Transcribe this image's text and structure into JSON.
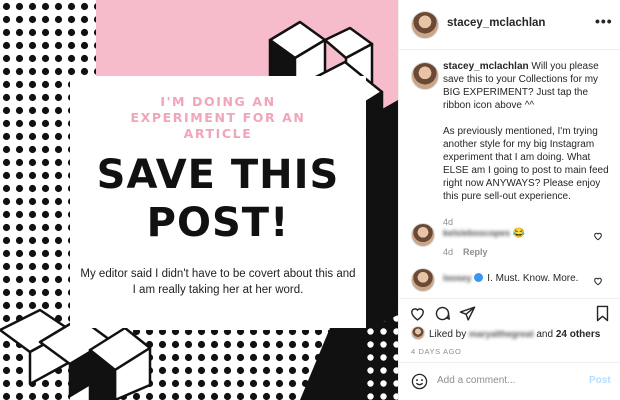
{
  "poster": {
    "pre_title_lines": [
      "I'M DOING AN",
      "EXPERIMENT FOR AN",
      "ARTICLE"
    ],
    "title_lines": [
      "SAVE THIS",
      "POST!"
    ],
    "body": "My editor said I didn't have to be covert about this and I am really taking her at her word.",
    "colors": {
      "pink": "#f7bccb",
      "pink_text": "#f2a4b8",
      "black": "#111111"
    }
  },
  "header": {
    "username": "stacey_mclachlan",
    "more_icon": "more-horizontal-icon",
    "more_label": "•••"
  },
  "caption": {
    "username": "stacey_mclachlan",
    "paragraph1": "Will you please save this to your Collections for my BIG EXPERIMENT? Just tap the ribbon icon above ^^",
    "paragraph2": "As previously mentioned, I'm trying another style for my big Instagram experiment that I am doing. What ELSE am I going to post to main feed right now ANYWAYS? Please enjoy this pure sell-out experience.",
    "time": "4d"
  },
  "comments": [
    {
      "username": "kelsieboscopes",
      "text": "😂",
      "time": "4d",
      "reply_label": "Reply"
    },
    {
      "username": "loosey",
      "text": "I. Must. Know. More."
    }
  ],
  "actions": {
    "icons": [
      "heart-icon",
      "comment-icon",
      "share-icon",
      "bookmark-icon"
    ]
  },
  "likes": {
    "prefix": "Liked by",
    "liker": "maryalthegreat",
    "middle": "and",
    "others": "24 others"
  },
  "date": "4 DAYS AGO",
  "add_comment": {
    "placeholder": "Add a comment...",
    "post_label": "Post",
    "post_color": "#b2dffc"
  }
}
